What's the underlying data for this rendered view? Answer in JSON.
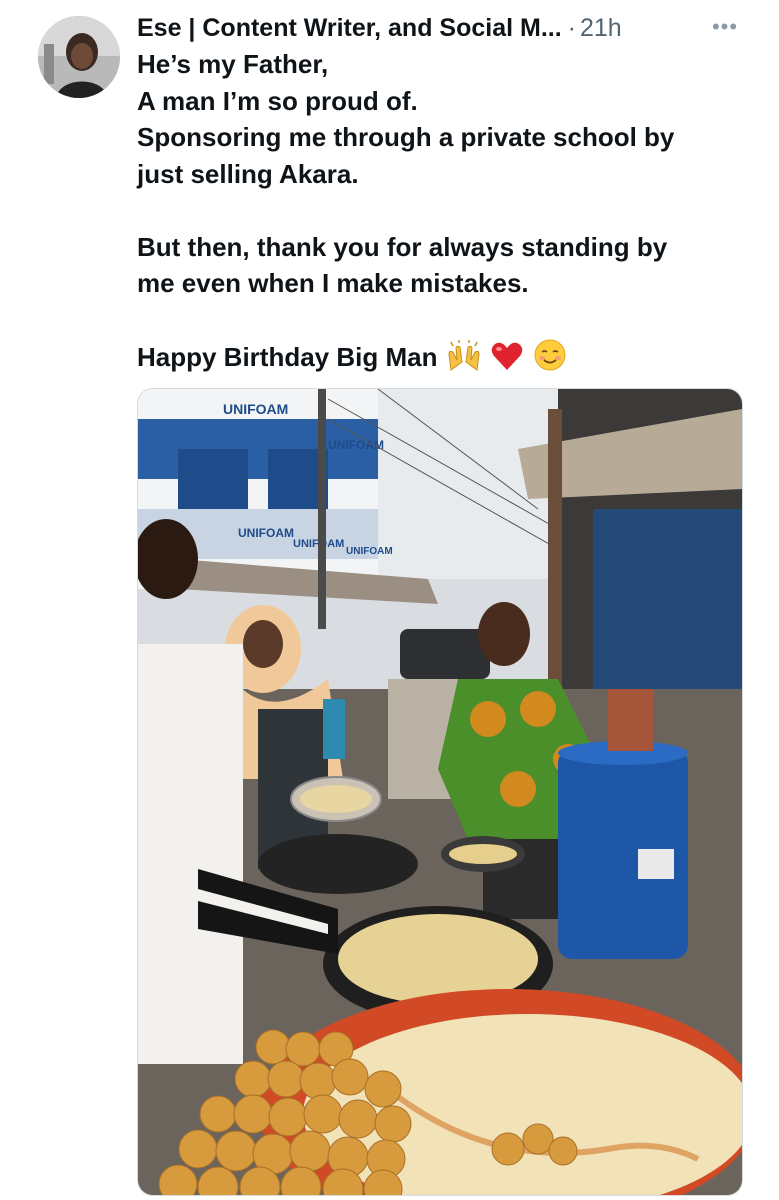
{
  "tweet": {
    "author": "Ese | Content Writer, and Social M...",
    "separator": "·",
    "time": "21h",
    "more_icon": "more-horizontal-icon",
    "lines": [
      "He’s my Father,",
      "A man I’m so proud of.",
      "Sponsoring me through a private school by",
      "just selling Akara.",
      "",
      "But then, thank you for always standing by",
      "me even when I make mistakes.",
      "",
      "Happy Birthday Big Man"
    ],
    "emojis": [
      "raising-hands-emoji",
      "red-heart-emoji",
      "relieved-face-emoji"
    ]
  },
  "media": {
    "signage": [
      "UNIFOAM",
      "UNIFOAM",
      "UNIFOAM",
      "UNIFOAM",
      "UNIFOAM"
    ]
  },
  "colors": {
    "secondary_text": "#536471",
    "shirt_green": "#4a8f2a",
    "barrel_blue": "#1e56a8",
    "hijab": "#f0c89a"
  }
}
